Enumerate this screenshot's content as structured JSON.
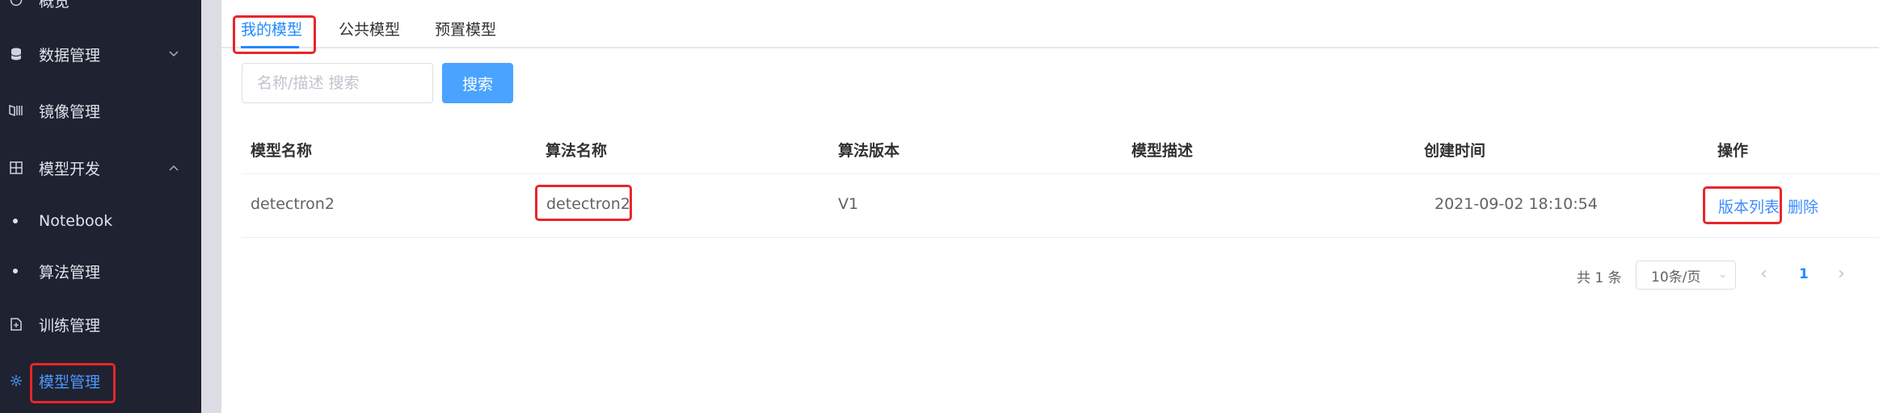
{
  "sidebar": {
    "items": [
      {
        "label": "概览",
        "icon": "dashboard-icon"
      },
      {
        "label": "数据管理",
        "icon": "database-icon",
        "arrow": "chevron-down-icon"
      },
      {
        "label": "镜像管理",
        "icon": "image-icon"
      },
      {
        "label": "模型开发",
        "icon": "grid-icon",
        "arrow": "chevron-up-icon"
      },
      {
        "label": "Notebook"
      },
      {
        "label": "算法管理"
      },
      {
        "label": "训练管理",
        "icon": "document-icon"
      },
      {
        "label": "模型管理",
        "icon": "gear-icon",
        "active": true
      }
    ]
  },
  "tabs": [
    {
      "label": "我的模型",
      "active": true
    },
    {
      "label": "公共模型"
    },
    {
      "label": "预置模型"
    }
  ],
  "search": {
    "placeholder": "名称/描述 搜索",
    "button_label": "搜索"
  },
  "table": {
    "headers": [
      "模型名称",
      "算法名称",
      "算法版本",
      "模型描述",
      "创建时间",
      "操作"
    ],
    "rows": [
      {
        "model_name": "detectron2",
        "algorithm_name": "detectron2",
        "algorithm_version": "V1",
        "description": "",
        "created_at": "2021-09-02 18:10:54",
        "actions": [
          "版本列表",
          "删除"
        ]
      }
    ]
  },
  "pagination": {
    "total_text": "共 1 条",
    "page_size": "10条/页",
    "current_page": "1"
  },
  "colors": {
    "accent": "#1f8bff",
    "sidebar_bg": "#1f2230",
    "annotation": "#e8262b",
    "search_button": "#4aa3ff"
  }
}
